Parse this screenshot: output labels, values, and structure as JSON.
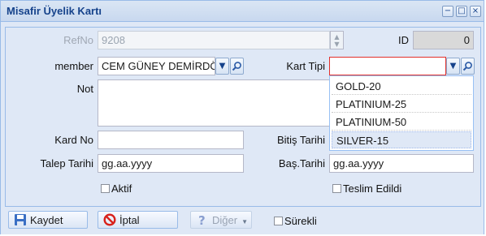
{
  "window": {
    "title": "Misafir Üyelik Kartı",
    "tools": [
      "−",
      "□",
      "×"
    ]
  },
  "form": {
    "refno": {
      "label": "RefNo",
      "value": "9208"
    },
    "id": {
      "label": "ID",
      "value": "0"
    },
    "member": {
      "label": "member",
      "value": "CEM GÜNEY DEMİRDÖ"
    },
    "kart_tipi": {
      "label": "Kart Tipi",
      "value": "",
      "options": [
        "GOLD-20",
        "PLATINIUM-25",
        "PLATINIUM-50",
        "SILVER-15"
      ],
      "highlighted": "SILVER-15"
    },
    "not": {
      "label": "Not",
      "value": ""
    },
    "kard_no": {
      "label": "Kard No",
      "value": ""
    },
    "bitis_tarihi": {
      "label": "Bitiş Tarihi",
      "value": ""
    },
    "talep_tarihi": {
      "label": "Talep Tarihi",
      "value": "gg.aa.yyyy"
    },
    "bas_tarihi": {
      "label": "Baş.Tarihi",
      "value": "gg.aa.yyyy"
    },
    "aktif": {
      "label": "Aktif",
      "checked": false
    },
    "teslim_edildi": {
      "label": "Teslim Edildi",
      "checked": false
    }
  },
  "toolbar": {
    "save_label": "Kaydet",
    "cancel_label": "İptal",
    "other_label": "Diğer",
    "surekli_label": "Sürekli",
    "surekli_checked": false
  },
  "colors": {
    "title_text": "#15428b",
    "panel_bg": "#dfe8f6",
    "border": "#99bbe8",
    "invalid_border": "#e2302b"
  },
  "icons": {
    "save": "floppy-disk-icon",
    "cancel": "red-circle-slash-icon",
    "other": "question-icon",
    "lookup": "magnifier-icon"
  }
}
